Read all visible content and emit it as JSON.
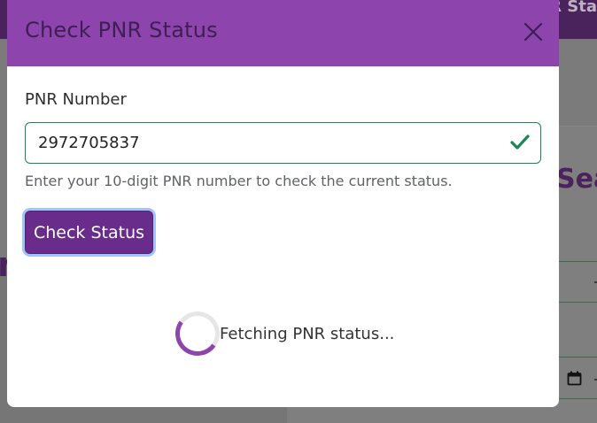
{
  "background": {
    "topbar_label": "R Sta",
    "card_title": "Sear",
    "left_glyph": "n",
    "calendar_icon": "calendar-icon"
  },
  "modal": {
    "title": "Check PNR Status",
    "close_icon": "close-icon",
    "pnr_label": "PNR Number",
    "pnr_value": "2972705837",
    "valid_icon": "check-icon",
    "help_text": "Enter your 10-digit PNR number to check the current status.",
    "check_button_label": "Check Status",
    "loading_text": "Fetching PNR status...",
    "spinner_icon": "spinner-icon"
  },
  "colors": {
    "header_purple": "#8e44ad",
    "button_purple": "#6a2c8a",
    "valid_green": "#198754",
    "focus_ring": "#9ec5fe"
  }
}
